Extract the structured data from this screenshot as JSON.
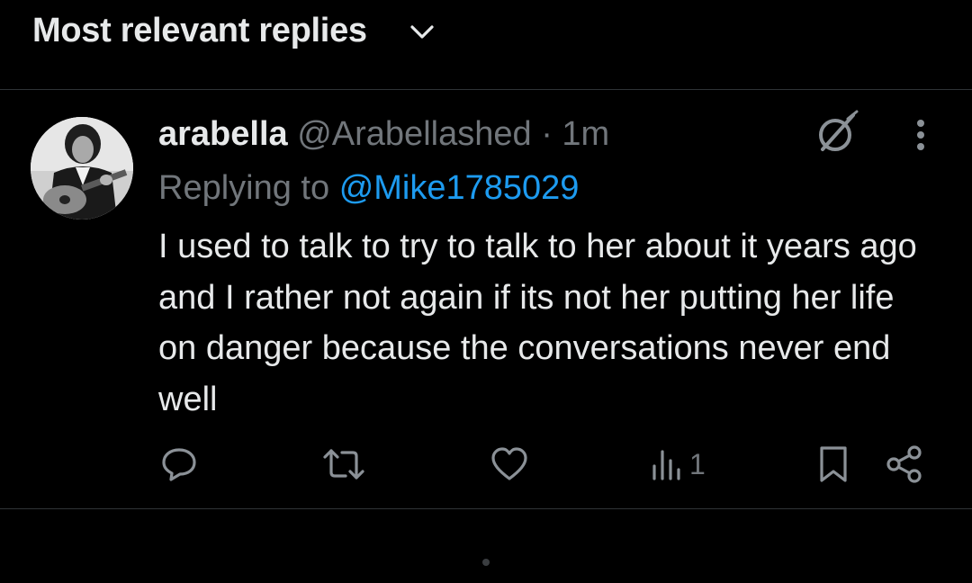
{
  "sort": {
    "label": "Most relevant replies"
  },
  "tweet": {
    "display_name": "arabella",
    "handle": "@Arabellashed",
    "separator": "·",
    "time": "1m",
    "reply_prefix": "Replying to",
    "reply_mention": "@Mike1785029",
    "text": "I used to talk to try to talk to her about it years ago and I rather not again if its not her putting her life on danger because the conversations never end well",
    "actions": {
      "reply_icon": "reply-bubble-icon",
      "repost_icon": "repost-icon",
      "like_icon": "heart-icon",
      "views_icon": "views-bar-chart-icon",
      "views_count": "1",
      "bookmark_icon": "bookmark-icon",
      "share_icon": "share-icon"
    }
  },
  "colors": {
    "background": "#000000",
    "text_primary": "#e7e9ea",
    "text_secondary": "#71767b",
    "accent": "#1d9bf0",
    "divider": "#2f3336"
  }
}
